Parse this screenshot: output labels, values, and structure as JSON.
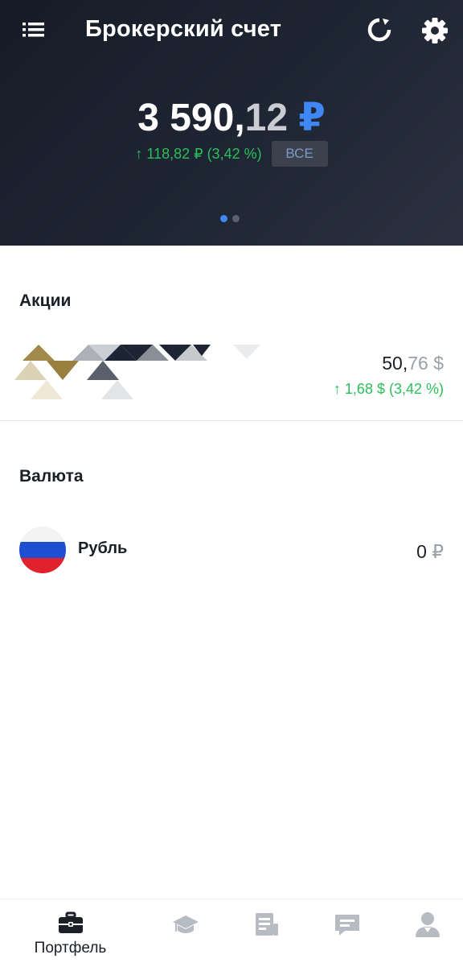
{
  "header": {
    "title": "Брокерский счет",
    "menu_icon": "list-menu-icon",
    "refresh_icon": "refresh-icon",
    "settings_icon": "gear-icon",
    "total": {
      "int": "3 590,",
      "dec": "12",
      "currency": "₽"
    },
    "change": "↑ 118,82 ₽ (3,42 %)",
    "period_button": "ВСЕ",
    "pager": {
      "count": 2,
      "active_index": 0
    }
  },
  "stocks": {
    "title": "Акции",
    "item": {
      "logo_icon": "triangle-pattern-logo",
      "price": {
        "int": "50,",
        "dec": "76",
        "currency": "$"
      },
      "change": "↑ 1,68 $ (3,42 %)"
    }
  },
  "currency": {
    "title": "Валюта",
    "item": {
      "flag_icon": "russia-flag-icon",
      "name": "Рубль",
      "value": "0",
      "currency": "₽"
    }
  },
  "bottom_nav": {
    "items": [
      {
        "label": "Портфель",
        "icon": "briefcase-icon",
        "active": true
      },
      {
        "label": "",
        "icon": "graduation-cap-icon",
        "active": false
      },
      {
        "label": "",
        "icon": "news-icon",
        "active": false
      },
      {
        "label": "",
        "icon": "chat-icon",
        "active": false
      },
      {
        "label": "",
        "icon": "profile-icon",
        "active": false
      }
    ]
  },
  "colors": {
    "accent": "#3f87f5",
    "positive": "#2bbf5a",
    "header_bg": "#1f2633",
    "muted": "#9aa0a8",
    "nav_inactive": "#b7bbc2"
  }
}
